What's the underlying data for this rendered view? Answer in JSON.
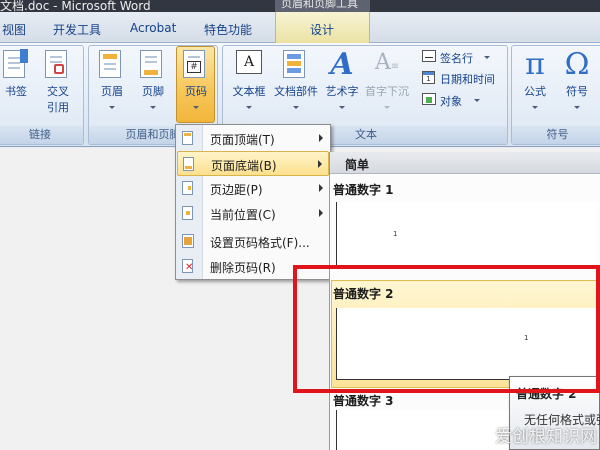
{
  "window": {
    "title": "文档.doc - Microsoft Word",
    "context_title": "页眉和页脚工具"
  },
  "tabs": [
    {
      "label": "视图"
    },
    {
      "label": "开发工具"
    },
    {
      "label": "Acrobat"
    },
    {
      "label": "特色功能"
    },
    {
      "label": "设计"
    }
  ],
  "ribbon": {
    "links_group": {
      "label": "链接",
      "bookmark": "书签",
      "crossref_line1": "交叉",
      "crossref_line2": "引用"
    },
    "header_footer_group": {
      "label": "页眉和页脚",
      "header": "页眉",
      "footer": "页脚",
      "page_number": "页码"
    },
    "text_group": {
      "label": "文本",
      "textbox": "文本框",
      "quickparts": "文档部件",
      "wordart": "艺术字",
      "dropcap": "首字下沉",
      "signature": "签名行",
      "datetime": "日期和时间",
      "object": "对象"
    },
    "symbols_group": {
      "label": "符号",
      "formula": "公式",
      "symbol": "符号",
      "formula_glyph": "π",
      "symbol_glyph": "Ω"
    }
  },
  "page_number_menu": {
    "items": [
      {
        "label": "页面顶端(T)"
      },
      {
        "label": "页面底端(B)"
      },
      {
        "label": "页边距(P)"
      },
      {
        "label": "当前位置(C)"
      },
      {
        "label": "设置页码格式(F)..."
      },
      {
        "label": "删除页码(R)"
      }
    ],
    "highlighted_index": 1
  },
  "gallery": {
    "section_header": "简单",
    "items": [
      {
        "title": "普通数字 1",
        "sample": "1"
      },
      {
        "title": "普通数字 2",
        "sample": "1"
      },
      {
        "title": "普通数字 3",
        "sample": ""
      }
    ],
    "selected_index": 1
  },
  "tooltip": {
    "title": "普通数字 2",
    "description": "无任何格式或强"
  },
  "watermark": {
    "text": "爱创根知识网"
  },
  "colors": {
    "accent_highlight": "#fbe08d",
    "annotation_red": "#e0141b",
    "ribbon_text": "#15428b"
  }
}
